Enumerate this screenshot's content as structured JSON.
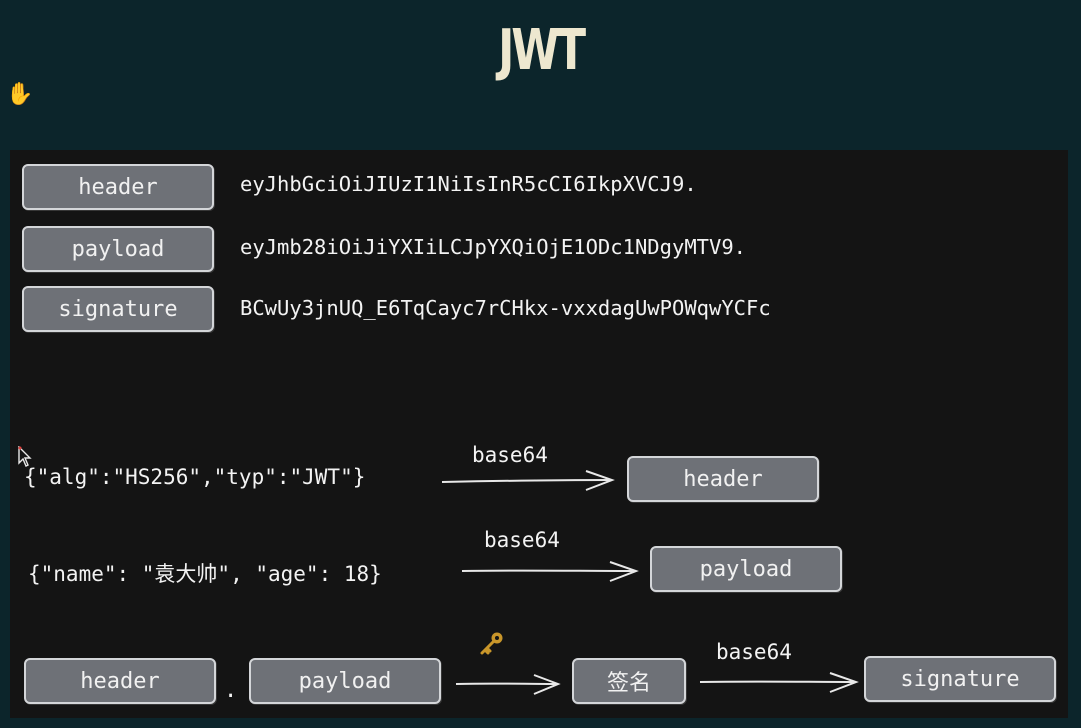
{
  "title": "JWT",
  "parts": [
    {
      "label": "header",
      "value": "eyJhbGciOiJIUzI1NiIsInR5cCI6IkpXVCJ9."
    },
    {
      "label": "payload",
      "value": "eyJmb28iOiJiYXIiLCJpYXQiOjE1ODc1NDgyMTV9."
    },
    {
      "label": "signature",
      "value": "BCwUy3jnUQ_E6TqCayc7rCHkx-vxxdagUwPOWqwYCFc"
    }
  ],
  "flow": {
    "header_json": "{\"alg\":\"HS256\",\"typ\":\"JWT\"}",
    "payload_json": "{\"name\": \"袁大帅\", \"age\": 18}",
    "encode_label": "base64",
    "header_box": "header",
    "payload_box": "payload",
    "sig_input_header": "header",
    "sig_input_payload": "payload",
    "dot": ".",
    "sign_box": "签名",
    "signature_box": "signature"
  },
  "colors": {
    "background": "#0c252b",
    "panel": "#141414",
    "box_fill": "#6e7177",
    "box_border": "#d4d6d9",
    "title": "#ede7cf",
    "key": "#c9962a"
  },
  "icons": [
    "hand-cursor-icon",
    "pointer-cursor-icon",
    "key-icon"
  ]
}
